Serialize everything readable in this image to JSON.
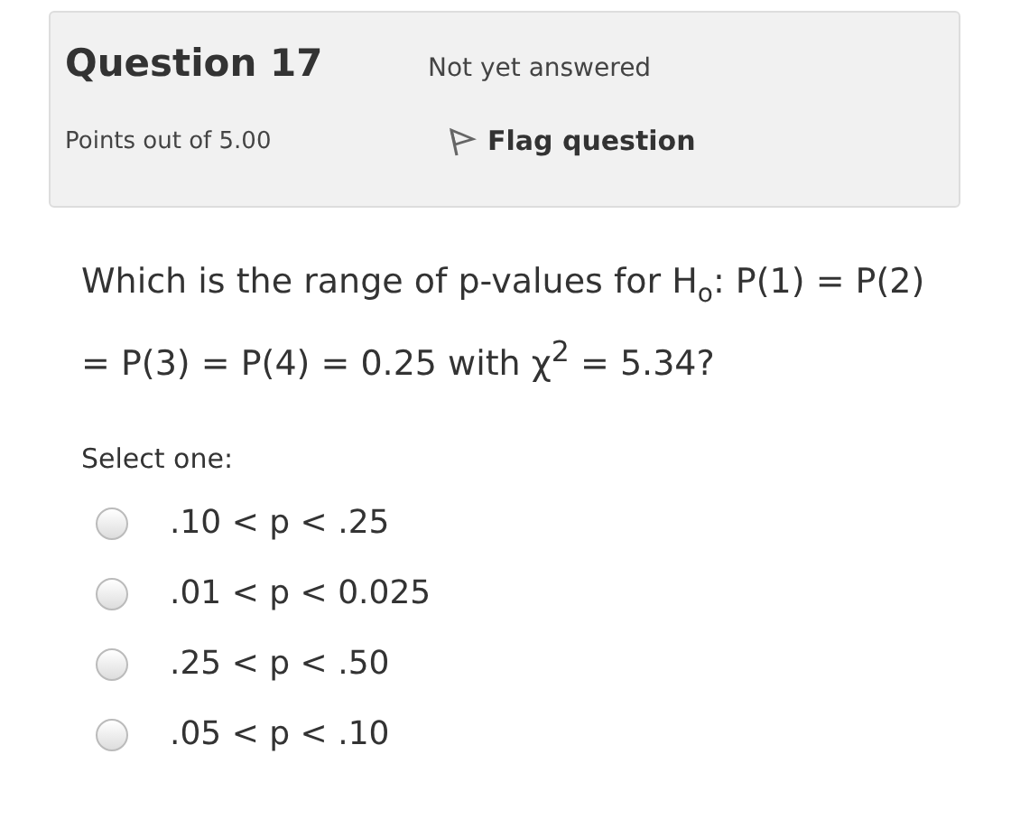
{
  "info": {
    "title": "Question 17",
    "status": "Not yet answered",
    "points": "Points out of 5.00",
    "flag": {
      "label": "Flag question",
      "flagged": false
    }
  },
  "question": "Which is the range of p-values for H$_{o}$: P(1) = P(2) = P(3) = P(4) = 0.25 with χ$^{2}$ = 5.34?",
  "prompt": "Select one:",
  "options": [
    {
      "label": ".10 < p < .25",
      "selected": false
    },
    {
      "label": ".01 < p < 0.025",
      "selected": false
    },
    {
      "label": ".25 < p < .50",
      "selected": false
    },
    {
      "label": ".05 < p < .10",
      "selected": false
    }
  ]
}
